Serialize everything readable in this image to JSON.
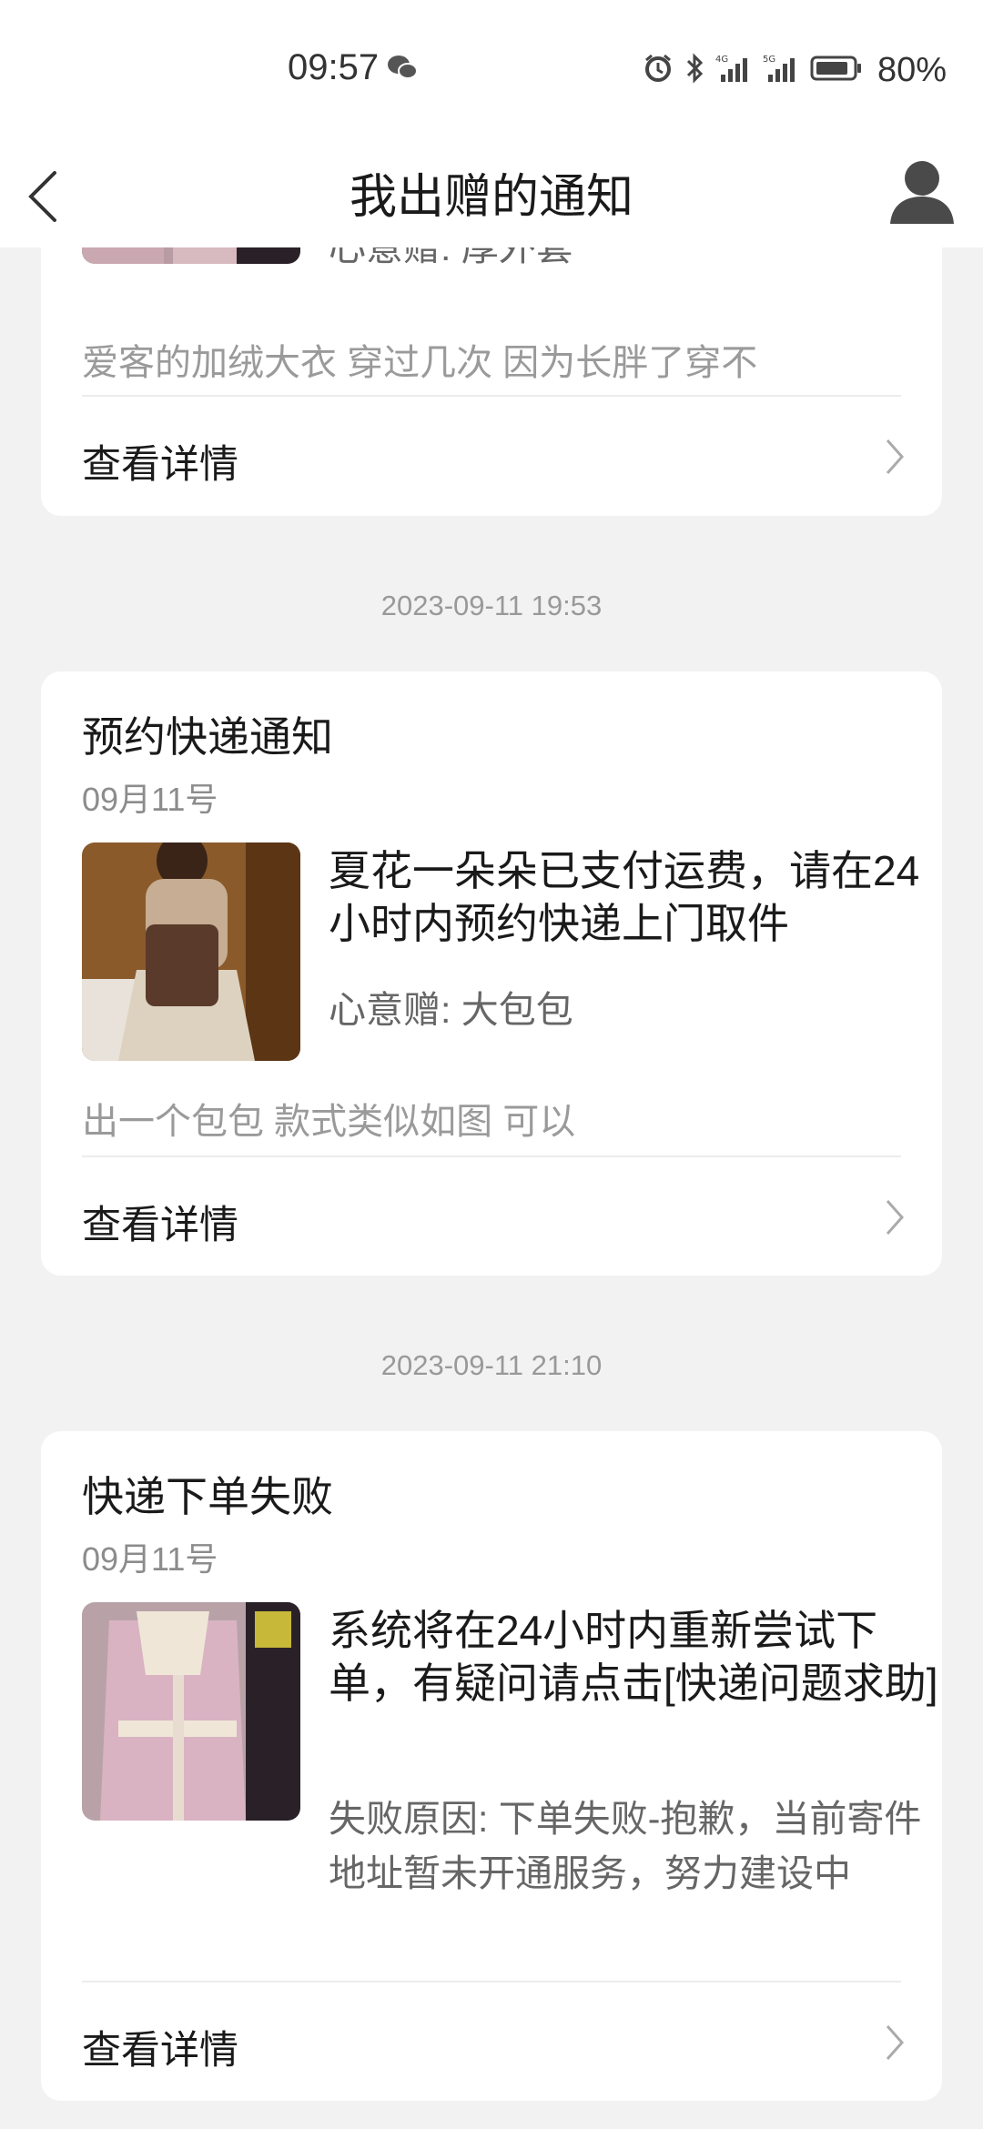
{
  "status_bar": {
    "time": "09:57",
    "battery": "80%",
    "icons": [
      "wechat-icon",
      "alarm-icon",
      "bluetooth-icon",
      "signal-4g-icon",
      "signal-5g-icon",
      "battery-icon"
    ]
  },
  "header": {
    "title": "我出赠的通知",
    "back_icon": "chevron-left-icon",
    "profile_icon": "user-icon"
  },
  "cards": [
    {
      "sub": "心意赠: 厚外套",
      "note": "爱客的加绒大衣 穿过几次 因为长胖了穿不",
      "detail": "查看详情",
      "thumb_icon": "pink-coat-photo"
    },
    {
      "timestamp": "2023-09-11 19:53",
      "title": "预约快递通知",
      "date": "09月11号",
      "message": "夏花一朵朵已支付运费，请在24小时内预约快递上门取件",
      "sub": "心意赠: 大包包",
      "note": "出一个包包 款式类似如图 可以",
      "detail": "查看详情",
      "thumb_icon": "brown-bag-photo"
    },
    {
      "timestamp": "2023-09-11 21:10",
      "title": "快递下单失败",
      "date": "09月11号",
      "message": "系统将在24小时内重新尝试下单，有疑问请点击[快递问题求助]",
      "sub": "失败原因: 下单失败-抱歉，当前寄件地址暂未开通服务，努力建设中",
      "detail": "查看详情",
      "thumb_icon": "pink-coat-photo"
    }
  ],
  "colors": {
    "background": "#f2f2f2",
    "card": "#ffffff",
    "muted_text": "#8c8c8c"
  }
}
